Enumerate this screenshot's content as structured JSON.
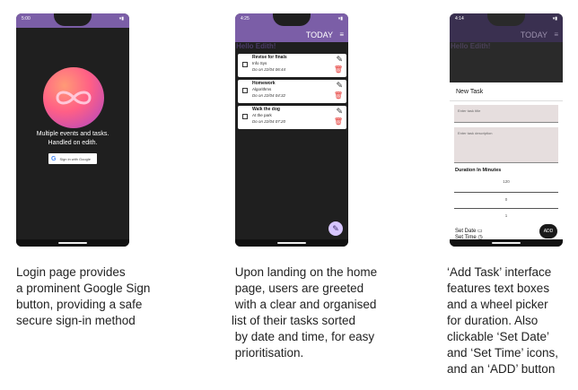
{
  "phone1": {
    "clock": "5:00",
    "tagline": [
      "Multiple events and tasks.",
      "Handled on edith."
    ],
    "google_button_label": "Sign in with Google",
    "google_logo": "G"
  },
  "phone2": {
    "clock": "4:25",
    "appbar_title": "TODAY",
    "greeting": "Hello Edith!",
    "tasks": [
      {
        "title": "Revise for finals",
        "subtitle": "Info Sys",
        "due": "Do on 22/04 06:44"
      },
      {
        "title": "Homework",
        "subtitle": "Algorithms",
        "due": "Do on 22/04 04:32"
      },
      {
        "title": "Walk the dog",
        "subtitle": "At the park",
        "due": "Do on 22/04 07:20"
      }
    ]
  },
  "phone3": {
    "clock": "4:14",
    "appbar_title": "TODAY",
    "greeting": "Hello Edith!",
    "dialog_title": "New Task",
    "title_placeholder": "Enter task title",
    "description_placeholder": "Enter task description",
    "duration_label": "Duration In Minutes",
    "wheel_values": [
      "120",
      "0",
      "1"
    ],
    "set_date_label": "Set Date",
    "set_time_label": "Set Time",
    "add_button_label": "ADD"
  },
  "captions": {
    "login": "Login page provides\na prominent Google Sign\nbutton, providing a safe\nsecure sign-in method",
    "home": " Upon landing on the home\n page, users are greeted\n with a clear and organised\nlist of their tasks sorted\n by date and time, for easy\n prioritisation.",
    "add_task": "‘Add Task’ interface\nfeatures text boxes\nand a wheel picker\nfor duration. Also\nclickable ‘Set Date’\nand ‘Set Time’ icons,\nand an ‘ADD’ button"
  },
  "colors": {
    "primary": "#7b5ea7",
    "delete": "#e53935",
    "fab": "#d7c6ff"
  }
}
